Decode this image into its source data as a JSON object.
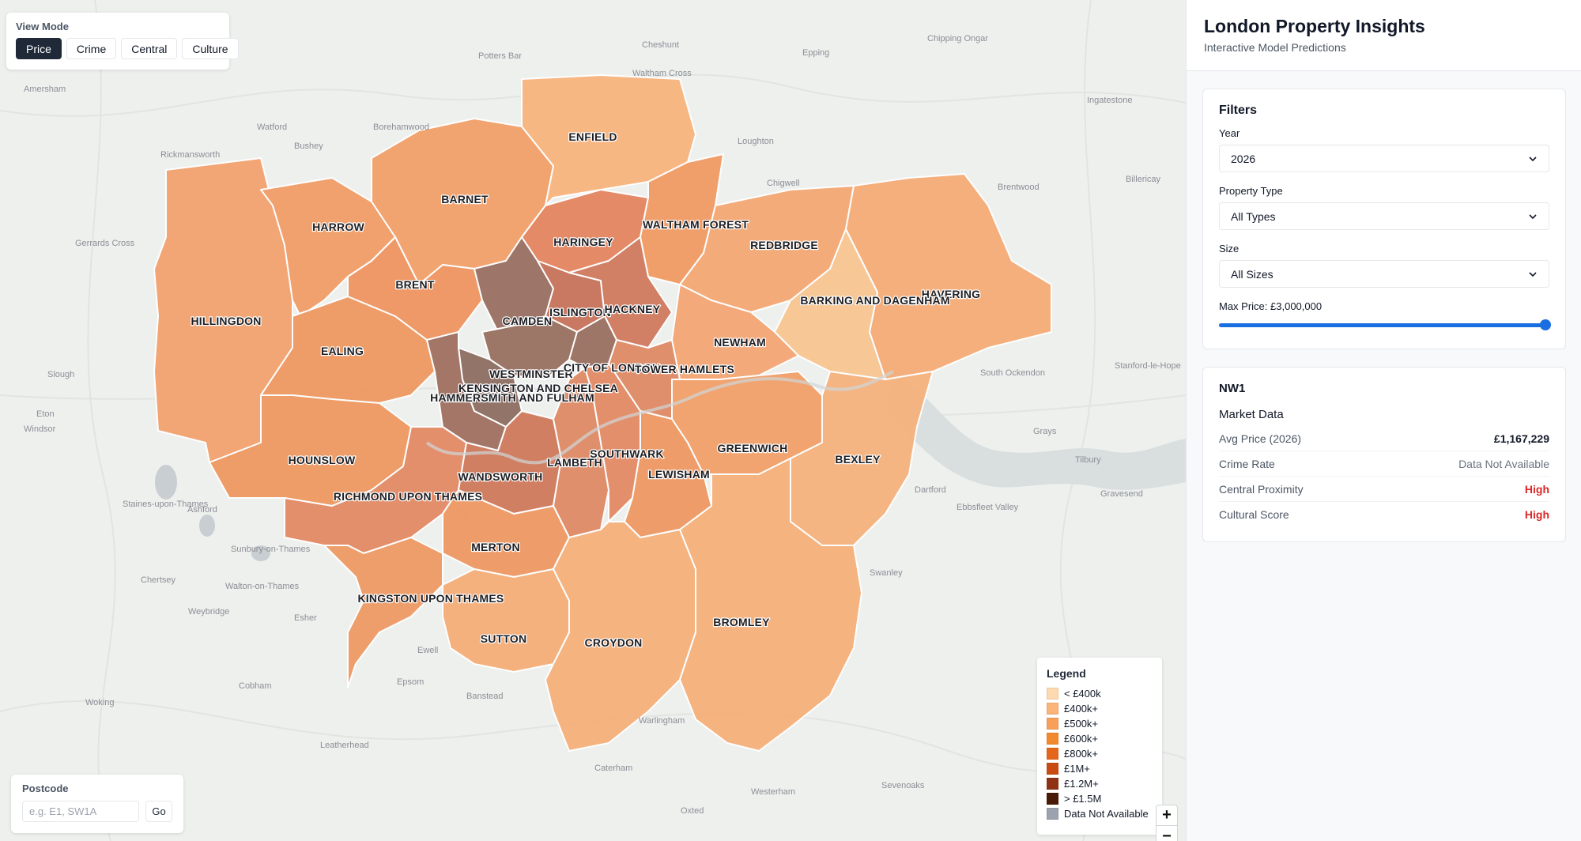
{
  "view_mode": {
    "title": "View Mode",
    "buttons": [
      {
        "label": "Price",
        "active": true
      },
      {
        "label": "Crime",
        "active": false
      },
      {
        "label": "Central",
        "active": false
      },
      {
        "label": "Culture",
        "active": false
      }
    ]
  },
  "postcode": {
    "title": "Postcode",
    "placeholder": "e.g. E1, SW1A",
    "go_label": "Go"
  },
  "legend": {
    "title": "Legend",
    "items": [
      {
        "label": "< £400k",
        "color": "#fdd9b0"
      },
      {
        "label": "£400k+",
        "color": "#fbb47a"
      },
      {
        "label": "£500k+",
        "color": "#f8a05a"
      },
      {
        "label": "£600k+",
        "color": "#f3892f"
      },
      {
        "label": "£800k+",
        "color": "#e5661a"
      },
      {
        "label": "£1M+",
        "color": "#c94b12"
      },
      {
        "label": "£1.2M+",
        "color": "#8f3214"
      },
      {
        "label": "> £1.5M",
        "color": "#4a1a08"
      },
      {
        "label": "Data Not Available",
        "color": "#9ca3af"
      }
    ]
  },
  "zoom": {
    "in_label": "+",
    "out_label": "−"
  },
  "panel": {
    "title": "London Property Insights",
    "subtitle": "Interactive Model Predictions"
  },
  "filters": {
    "title": "Filters",
    "year": {
      "label": "Year",
      "value": "2026"
    },
    "property_type": {
      "label": "Property Type",
      "value": "All Types"
    },
    "size": {
      "label": "Size",
      "value": "All Sizes"
    },
    "max_price": {
      "label": "Max Price: £3,000,000",
      "fraction": 1.0
    }
  },
  "info": {
    "postcode": "NW1",
    "section_title": "Market Data",
    "rows": [
      {
        "key": "Avg Price (2026)",
        "value": "£1,167,229",
        "style": "bold"
      },
      {
        "key": "Crime Rate",
        "value": "Data Not Available",
        "style": "na"
      },
      {
        "key": "Central Proximity",
        "value": "High",
        "style": "high"
      },
      {
        "key": "Cultural Score",
        "value": "High",
        "style": "high"
      }
    ]
  },
  "map": {
    "boroughs": [
      {
        "name": "ENFIELD",
        "shade": "#f8b47e"
      },
      {
        "name": "BARNET",
        "shade": "#f3a06a"
      },
      {
        "name": "HARROW",
        "shade": "#f19d67"
      },
      {
        "name": "HILLINGDON",
        "shade": "#f3a36f"
      },
      {
        "name": "BRENT",
        "shade": "#ee9560"
      },
      {
        "name": "EALING",
        "shade": "#ee9861"
      },
      {
        "name": "HOUNSLOW",
        "shade": "#ee9861"
      },
      {
        "name": "HARINGEY",
        "shade": "#e48560"
      },
      {
        "name": "WALTHAM FOREST",
        "shade": "#f19b65"
      },
      {
        "name": "REDBRIDGE",
        "shade": "#f4a873"
      },
      {
        "name": "HAVERING",
        "shade": "#f5ac78"
      },
      {
        "name": "BARKING AND DAGENHAM",
        "shade": "#f8c592"
      },
      {
        "name": "NEWHAM",
        "shade": "#f4a674"
      },
      {
        "name": "CAMDEN",
        "shade": "#9a6f62"
      },
      {
        "name": "ISLINGTON",
        "shade": "#c8725a"
      },
      {
        "name": "HACKNEY",
        "shade": "#d07a5e"
      },
      {
        "name": "WESTMINSTER",
        "shade": "#98705f"
      },
      {
        "name": "CITY OF LONDON",
        "shade": "#9a7060"
      },
      {
        "name": "TOWER HAMLETS",
        "shade": "#e08a66"
      },
      {
        "name": "KENSINGTON AND CHELSEA",
        "shade": "#8e6e62"
      },
      {
        "name": "HAMMERSMITH AND FULHAM",
        "shade": "#a07060"
      },
      {
        "name": "RICHMOND UPON THAMES",
        "shade": "#e48a66"
      },
      {
        "name": "WANDSWORTH",
        "shade": "#d07a5c"
      },
      {
        "name": "LAMBETH",
        "shade": "#e08a66"
      },
      {
        "name": "SOUTHWARK",
        "shade": "#e38a64"
      },
      {
        "name": "LEWISHAM",
        "shade": "#ef9963"
      },
      {
        "name": "GREENWICH",
        "shade": "#f2a06a"
      },
      {
        "name": "BEXLEY",
        "shade": "#f6b27e"
      },
      {
        "name": "MERTON",
        "shade": "#ef9963"
      },
      {
        "name": "KINGSTON UPON THAMES",
        "shade": "#ef9a64"
      },
      {
        "name": "SUTTON",
        "shade": "#f5ad78"
      },
      {
        "name": "CROYDON",
        "shade": "#f6b07b"
      },
      {
        "name": "BROMLEY",
        "shade": "#f6b07b"
      }
    ],
    "towns": [
      "Potters Bar",
      "Cheshunt",
      "Epping",
      "Chipping Ongar",
      "Waltham Cross",
      "Amersham",
      "Watford",
      "Borehamwood",
      "Bushey",
      "Rickmansworth",
      "Loughton",
      "Chigwell",
      "Brentwood",
      "Billericay",
      "Ingatestone",
      "Gerrards Cross",
      "Slough",
      "Eton",
      "Windsor",
      "Staines-upon-Thames",
      "Ashford",
      "Sunbury-on-Thames",
      "Chertsey",
      "Walton-on-Thames",
      "Weybridge",
      "Esher",
      "Ewell",
      "Epsom",
      "Banstead",
      "Cobham",
      "Leatherhead",
      "Woking",
      "Caterham",
      "Westerham",
      "Oxted",
      "Warlingham",
      "Sevenoaks",
      "Dartford",
      "Ebbsfleet Valley",
      "Gravesend",
      "Tilbury",
      "Grays",
      "South Ockendon",
      "Stanford-le-Hope",
      "Swanley"
    ]
  }
}
